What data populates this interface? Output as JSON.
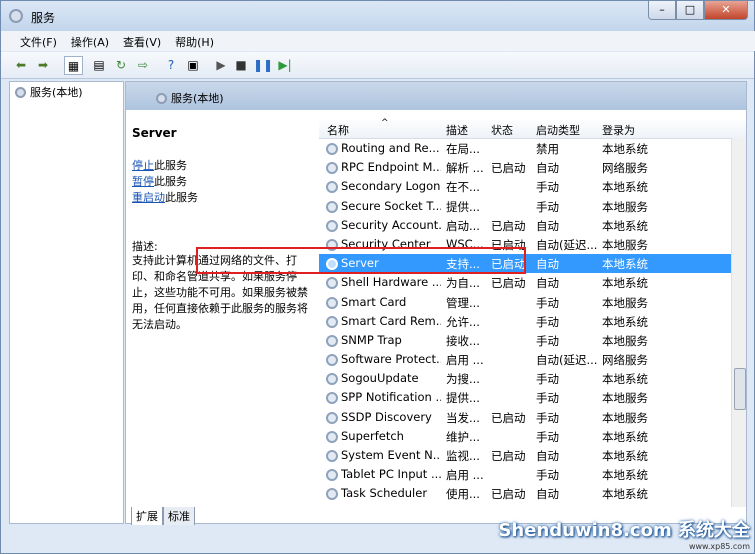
{
  "window": {
    "title": "服务",
    "min": "–",
    "max": "□",
    "close": "✕"
  },
  "menu": [
    "文件(F)",
    "操作(A)",
    "查看(V)",
    "帮助(H)"
  ],
  "left_pane": {
    "item": "服务(本地)"
  },
  "main": {
    "header": "服务(本地)",
    "selected_service": "Server",
    "actions": [
      {
        "link": "停止",
        "rest": "此服务"
      },
      {
        "link": "暂停",
        "rest": "此服务"
      },
      {
        "link": "重启动",
        "rest": "此服务"
      }
    ],
    "desc_label": "描述:",
    "desc_text": "支持此计算机通过网络的文件、打印、和命名管道共享。如果服务停止，这些功能不可用。如果服务被禁用，任何直接依赖于此服务的服务将无法启动。"
  },
  "columns": {
    "name": "名称",
    "desc": "描述",
    "status": "状态",
    "startup": "启动类型",
    "logon": "登录为"
  },
  "rows": [
    {
      "name": "Routing and Re...",
      "desc": "在局...",
      "status": "",
      "startup": "禁用",
      "logon": "本地系统"
    },
    {
      "name": "RPC Endpoint M...",
      "desc": "解析 ...",
      "status": "已启动",
      "startup": "自动",
      "logon": "网络服务"
    },
    {
      "name": "Secondary Logon",
      "desc": "在不...",
      "status": "",
      "startup": "手动",
      "logon": "本地系统"
    },
    {
      "name": "Secure Socket T...",
      "desc": "提供...",
      "status": "",
      "startup": "手动",
      "logon": "本地服务"
    },
    {
      "name": "Security Account...",
      "desc": "启动...",
      "status": "已启动",
      "startup": "自动",
      "logon": "本地系统"
    },
    {
      "name": "Security Center",
      "desc": "WSC...",
      "status": "已启动",
      "startup": "自动(延迟...",
      "logon": "本地服务"
    },
    {
      "name": "Server",
      "desc": "支持...",
      "status": "已启动",
      "startup": "自动",
      "logon": "本地系统",
      "selected": true
    },
    {
      "name": "Shell Hardware ...",
      "desc": "为自...",
      "status": "已启动",
      "startup": "自动",
      "logon": "本地系统"
    },
    {
      "name": "Smart Card",
      "desc": "管理...",
      "status": "",
      "startup": "手动",
      "logon": "本地服务"
    },
    {
      "name": "Smart Card Rem...",
      "desc": "允许...",
      "status": "",
      "startup": "手动",
      "logon": "本地系统"
    },
    {
      "name": "SNMP Trap",
      "desc": "接收...",
      "status": "",
      "startup": "手动",
      "logon": "本地服务"
    },
    {
      "name": "Software Protect...",
      "desc": "启用 ...",
      "status": "",
      "startup": "自动(延迟...",
      "logon": "网络服务"
    },
    {
      "name": "SogouUpdate",
      "desc": "为搜...",
      "status": "",
      "startup": "手动",
      "logon": "本地系统"
    },
    {
      "name": "SPP Notification ...",
      "desc": "提供...",
      "status": "",
      "startup": "手动",
      "logon": "本地服务"
    },
    {
      "name": "SSDP Discovery",
      "desc": "当发...",
      "status": "已启动",
      "startup": "手动",
      "logon": "本地服务"
    },
    {
      "name": "Superfetch",
      "desc": "维护...",
      "status": "",
      "startup": "手动",
      "logon": "本地系统"
    },
    {
      "name": "System Event N...",
      "desc": "监视...",
      "status": "已启动",
      "startup": "自动",
      "logon": "本地系统"
    },
    {
      "name": "Tablet PC Input ...",
      "desc": "启用 ...",
      "status": "",
      "startup": "手动",
      "logon": "本地系统"
    },
    {
      "name": "Task Scheduler",
      "desc": "使用...",
      "status": "已启动",
      "startup": "自动",
      "logon": "本地系统"
    }
  ],
  "tabs": [
    "扩展",
    "标准"
  ],
  "watermark": {
    "text": "Shenduwin8.com 系统大全",
    "sub": "www.xp85.com"
  }
}
